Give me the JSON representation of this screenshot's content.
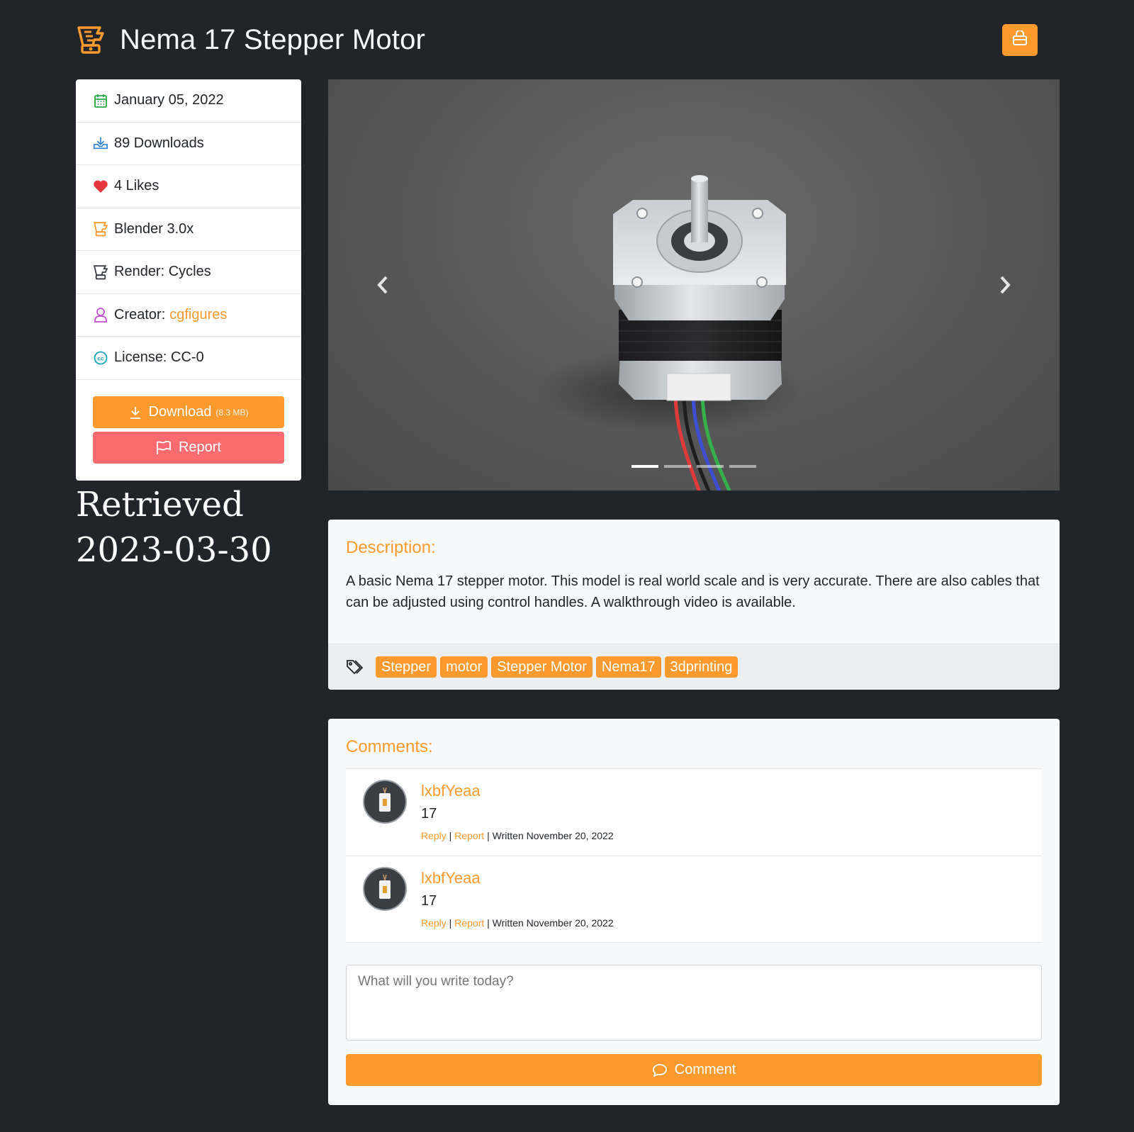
{
  "header": {
    "title": "Nema 17 Stepper Motor",
    "brand_icon": "blender-icon",
    "cart_icon": "basket-icon"
  },
  "info": {
    "date": "January 05, 2022",
    "downloads": "89 Downloads",
    "likes": "4 Likes",
    "software": "Blender 3.0x",
    "render": "Render: Cycles",
    "creator_label": "Creator:",
    "creator_name": "cgfigures",
    "license": "License: CC-0"
  },
  "actions": {
    "download_label": "Download",
    "download_size": "(8.3 MB)",
    "report_label": "Report"
  },
  "retrieved": "Retrieved 2023-03-30",
  "carousel": {
    "slides": 4,
    "active_slide": 1
  },
  "description": {
    "heading": "Description:",
    "text": "A basic Nema 17 stepper motor. This model is real world scale and is very accurate. There are also cables that can be adjusted using control handles. A walkthrough video is available.",
    "tags": [
      "Stepper",
      "motor",
      "Stepper Motor",
      "Nema17",
      "3dprinting"
    ]
  },
  "comments": {
    "heading": "Comments:",
    "items": [
      {
        "user": "lxbfYeaa",
        "body": "17",
        "reply": "Reply",
        "report": "Report",
        "written": "Written November 20, 2022"
      },
      {
        "user": "lxbfYeaa",
        "body": "17",
        "reply": "Reply",
        "report": "Report",
        "written": "Written November 20, 2022"
      }
    ],
    "placeholder": "What will you write today?",
    "submit_label": "Comment"
  },
  "colors": {
    "accent": "#fd9a2e",
    "danger": "#fb6b70",
    "background": "#212529"
  }
}
